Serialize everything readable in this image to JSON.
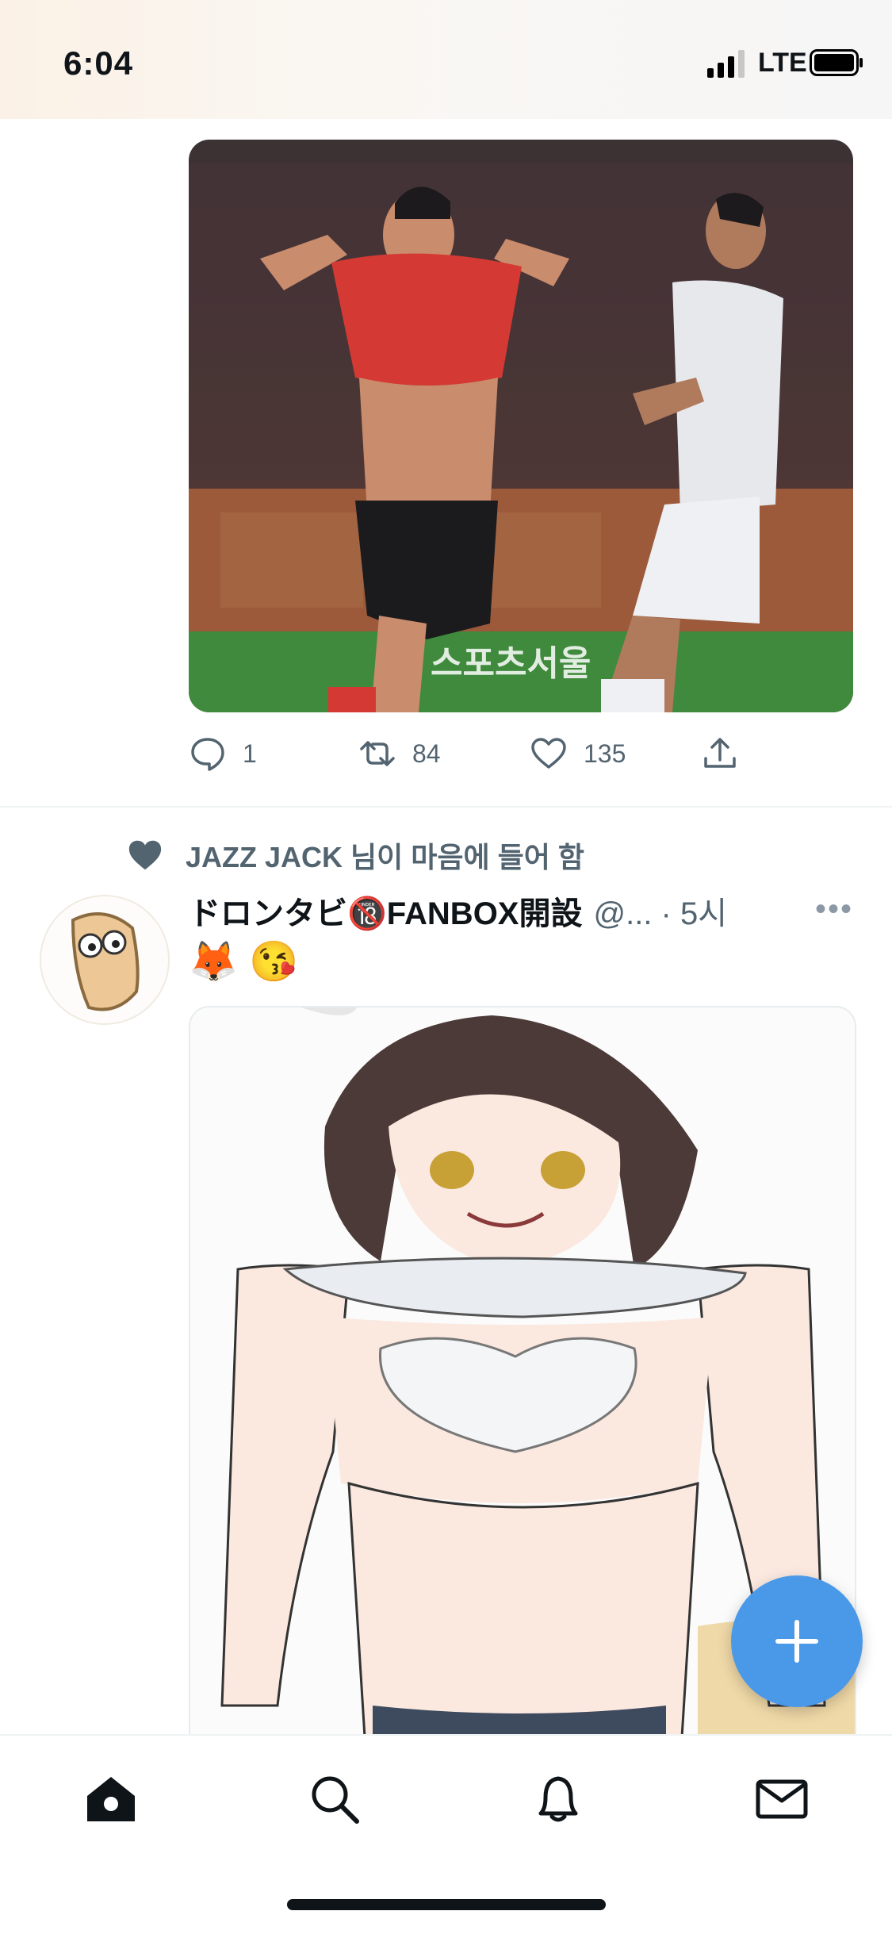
{
  "status_bar": {
    "time": "6:04",
    "network": "LTE"
  },
  "tweet1": {
    "media_watermark": "스포츠서울",
    "actions": {
      "replies": "1",
      "retweets": "84",
      "likes": "135"
    }
  },
  "tweet2": {
    "social_context": "JAZZ JACK 님이 마음에 들어 함",
    "display_name": "ドロンタビ🔞FANBOX開設",
    "handle_time": "@... · 5시",
    "text": "🦊 😘"
  },
  "colors": {
    "accent": "#4a99e9",
    "muted": "#536471",
    "divider": "#eff3f4"
  },
  "icons": [
    "reply-icon",
    "retweet-icon",
    "like-icon",
    "share-icon",
    "heart-icon",
    "more-icon",
    "compose-icon",
    "home-icon",
    "search-icon",
    "notifications-icon",
    "messages-icon"
  ]
}
